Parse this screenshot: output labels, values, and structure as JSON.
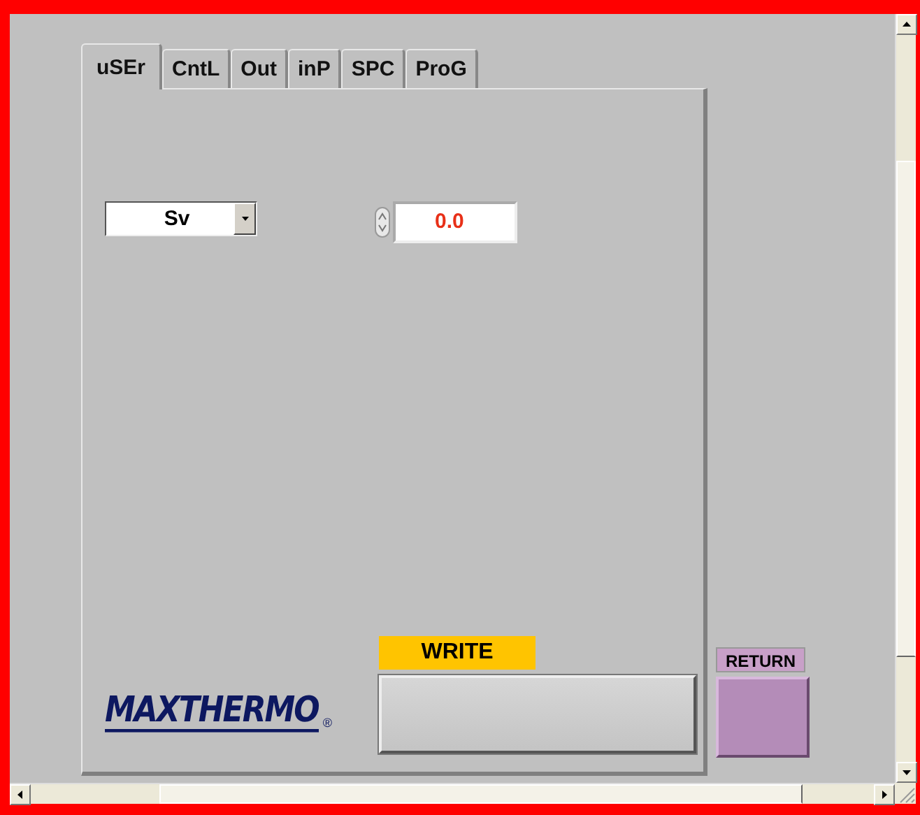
{
  "tabs": [
    {
      "label": "uSEr",
      "selected": true
    },
    {
      "label": "CntL",
      "selected": false
    },
    {
      "label": "Out",
      "selected": false
    },
    {
      "label": "inP",
      "selected": false
    },
    {
      "label": "SPC",
      "selected": false
    },
    {
      "label": "ProG",
      "selected": false
    }
  ],
  "parameter_select": {
    "value": "Sv"
  },
  "value_field": {
    "value": "0.0"
  },
  "logo": {
    "text": "MAXTHERMO",
    "mark": "®"
  },
  "write": {
    "label": "WRITE"
  },
  "return": {
    "label": "RETURN"
  }
}
